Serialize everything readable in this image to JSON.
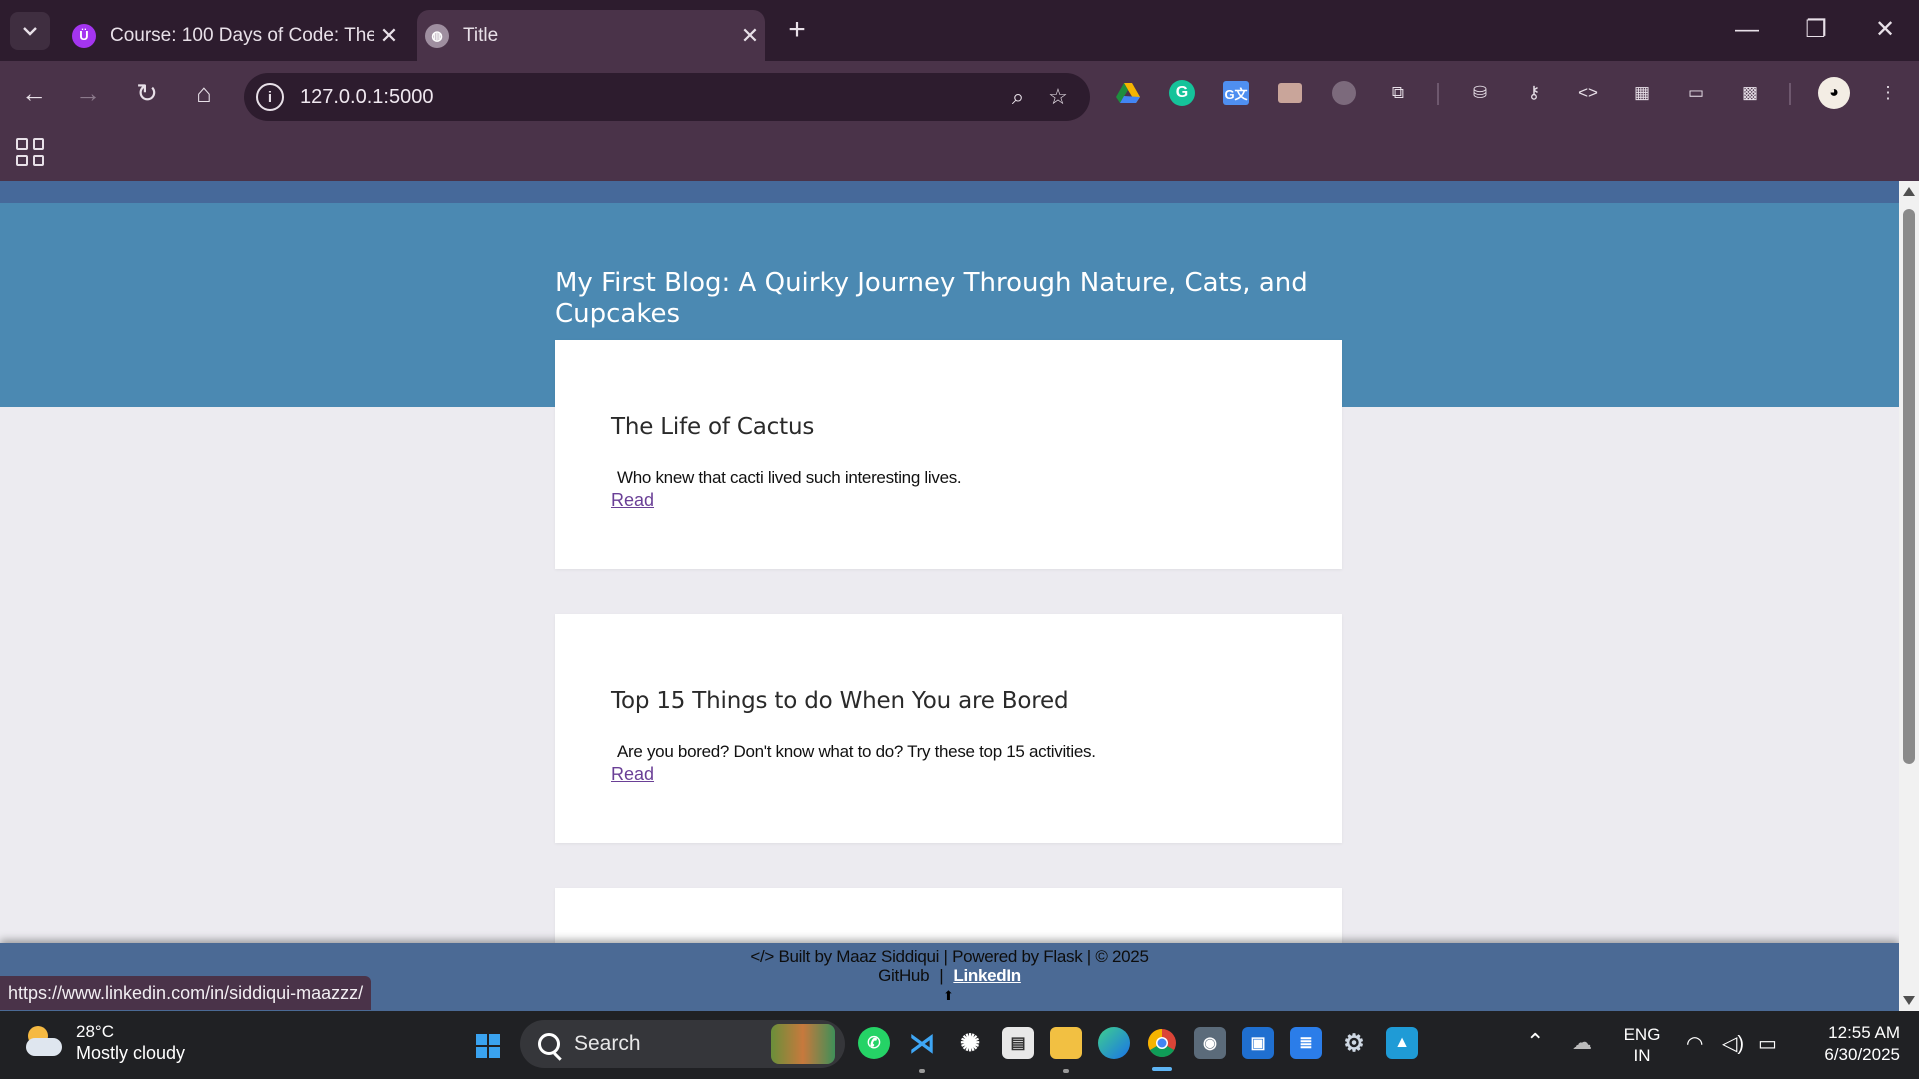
{
  "browser": {
    "tabs": [
      {
        "title": "Course: 100 Days of Code: The U",
        "favicon": "udemy-icon",
        "active": false
      },
      {
        "title": "Title",
        "favicon": "globe-icon",
        "active": true
      }
    ],
    "new_tab_icon": "+",
    "address": "127.0.0.1:5000",
    "extensions": [
      "google-drive-icon",
      "grammarly-icon",
      "google-translate-icon",
      "extension-icon",
      "extension-icon",
      "puzzle-icon",
      "incognito-icon",
      "password-key-icon",
      "code-icon",
      "table-icon",
      "responsive-icon",
      "qr-icon"
    ],
    "status_url": "https://www.linkedin.com/in/siddiqui-maazzz/"
  },
  "page": {
    "blog_title": "My First Blog: A Quirky Journey Through Nature, Cats, and Cupcakes",
    "posts": [
      {
        "title": "The Life of Cactus",
        "subtitle": "Who knew that cacti lived such interesting lives.",
        "link": "Read"
      },
      {
        "title": "Top 15 Things to do When You are Bored",
        "subtitle": "Are you bored? Don't know what to do? Try these top 15 activities.",
        "link": "Read"
      }
    ],
    "footer": {
      "credit": "</> Built by Maaz Siddiqui | Powered by Flask | © 2025",
      "github": "GitHub",
      "separator": "|",
      "linkedin": "LinkedIn"
    }
  },
  "taskbar": {
    "weather": {
      "temp": "28°C",
      "condition": "Mostly cloudy"
    },
    "search_label": "Search",
    "language": {
      "line1": "ENG",
      "line2": "IN"
    },
    "clock": {
      "time": "12:55 AM",
      "date": "6/30/2025"
    }
  },
  "colors": {
    "hero": "#4b89b2",
    "footer": "#4b6a95",
    "chrome": "#4a3349",
    "link": "#6a3f96"
  }
}
